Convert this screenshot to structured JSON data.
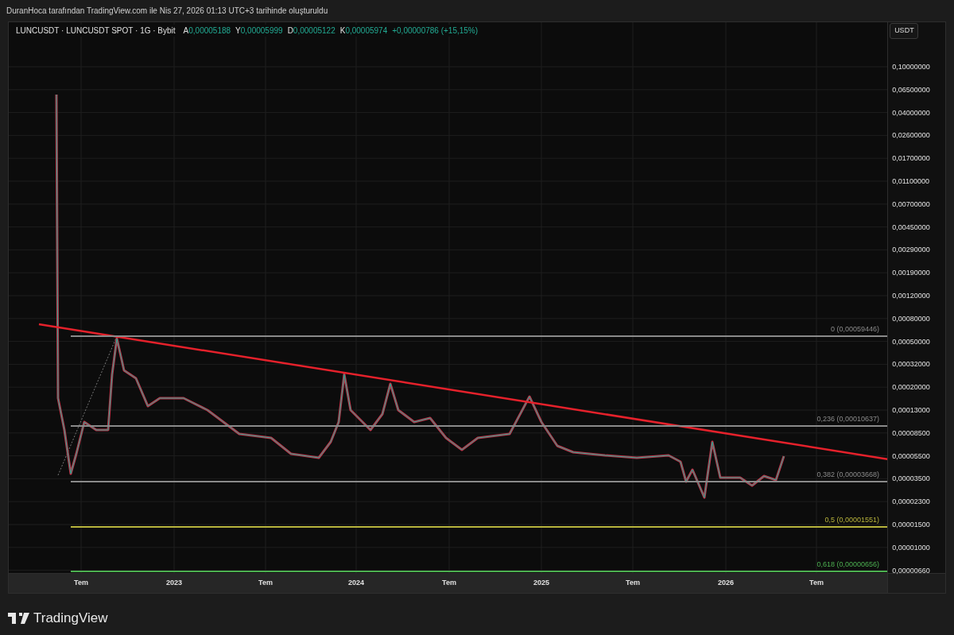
{
  "caption": "DuranHoca tarafından TradingView.com ile Nis 27, 2026 01:13 UTC+3 tarihinde oluşturuldu",
  "legend": {
    "symbol": "LUNCUSDT · LUNCUSDT SPOT · 1G · Bybit",
    "fields": [
      {
        "label": "A",
        "value": "0,00005188"
      },
      {
        "label": "Y",
        "value": "0,00005999"
      },
      {
        "label": "D",
        "value": "0,00005122"
      },
      {
        "label": "K",
        "value": "0,00005974"
      }
    ],
    "change": "+0,00000786 (+15,15%)"
  },
  "currency_button": "USDT",
  "price_axis": [
    "0,10000000",
    "0,06500000",
    "0,04000000",
    "0,02600000",
    "0,01700000",
    "0,01100000",
    "0,00700000",
    "0,00450000",
    "0,00290000",
    "0,00190000",
    "0,00120000",
    "0,00080000",
    "0,00050000",
    "0,00032000",
    "0,00020000",
    "0,00013000",
    "0,00008500",
    "0,00005500",
    "0,00003500",
    "0,00002300",
    "0,00001500",
    "0,00001000",
    "0,00000660"
  ],
  "time_axis": [
    "Tem",
    "2023",
    "Tem",
    "2024",
    "Tem",
    "2025",
    "Tem",
    "2026",
    "Tem"
  ],
  "fib_levels": [
    {
      "label": "0 (0,00059446)",
      "color": "#8a8a8a"
    },
    {
      "label": "0,236 (0,00010637)",
      "color": "#8a8a8a"
    },
    {
      "label": "0,382 (0,00003668)",
      "color": "#8a8a8a"
    },
    {
      "label": "0,5 (0,00001551)",
      "color": "#b8b43c"
    },
    {
      "label": "0,618 (0,00000656)",
      "color": "#4caf50"
    }
  ],
  "logo": "TradingView"
}
